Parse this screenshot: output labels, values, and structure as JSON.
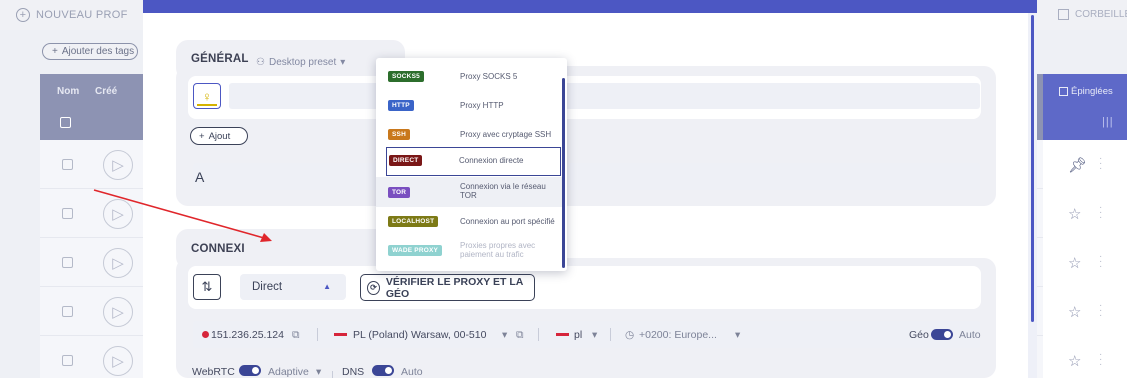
{
  "app": {
    "new_profile": "NOUVEAU PROF",
    "trash": "CORBEILLE",
    "add_tags": "Ajouter des tags",
    "columns": {
      "name": "Nom",
      "created": "Créé",
      "pinned": "Épinglées"
    }
  },
  "modal": {
    "general_title": "GÉNÉRAL",
    "preset": "Desktop preset",
    "add_button": "Ajout",
    "font_icon_text": "A",
    "connection_title": "CONNEXI",
    "proxy_select": "Direct",
    "verify_button": "VÉRIFIER LE PROXY ET LA GÉO",
    "info": {
      "ip": "151.236.25.124",
      "location": "PL (Poland) Warsaw, 00-510",
      "language": "pl",
      "timezone": "+0200: Europe...",
      "geo_label": "Géo",
      "geo_value": "Auto"
    },
    "webrtc_label": "WebRTC",
    "webrtc_value": "Adaptive",
    "dns_label": "DNS",
    "dns_value": "Auto"
  },
  "dropdown": {
    "items": [
      {
        "badge": "SOCKS5",
        "label": "Proxy SOCKS 5",
        "color": "#2c6e2c"
      },
      {
        "badge": "HTTP",
        "label": "Proxy HTTP",
        "color": "#3a64c8"
      },
      {
        "badge": "SSH",
        "label": "Proxy avec cryptage SSH",
        "color": "#c9781c"
      },
      {
        "badge": "DIRECT",
        "label": "Connexion directe",
        "color": "#7a1717"
      },
      {
        "badge": "TOR",
        "label": "Connexion via le réseau TOR",
        "color": "#7a4fc0"
      },
      {
        "badge": "LOCALHOST",
        "label": "Connexion au port spécifié",
        "color": "#7d7a16"
      },
      {
        "badge": "WADE PROXY",
        "label": "Proxies propres avec paiement au trafic",
        "color": "#8fd2d0"
      }
    ]
  }
}
